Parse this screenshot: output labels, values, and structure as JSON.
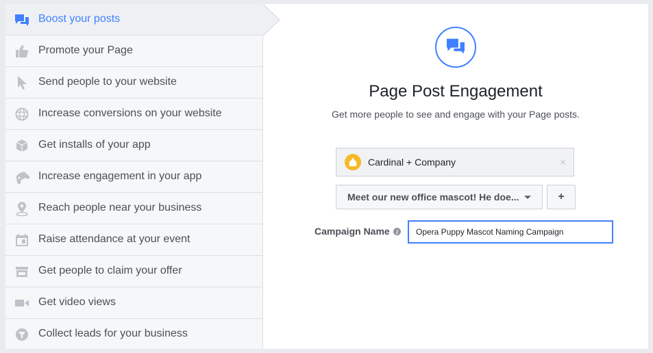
{
  "sidebar": {
    "items": [
      {
        "label": "Boost your posts",
        "icon": "speech-bubbles-icon",
        "active": true
      },
      {
        "label": "Promote your Page",
        "icon": "thumbs-up-icon"
      },
      {
        "label": "Send people to your website",
        "icon": "cursor-icon"
      },
      {
        "label": "Increase conversions on your website",
        "icon": "globe-icon"
      },
      {
        "label": "Get installs of your app",
        "icon": "box-icon"
      },
      {
        "label": "Increase engagement in your app",
        "icon": "gamepad-icon"
      },
      {
        "label": "Reach people near your business",
        "icon": "map-pin-icon"
      },
      {
        "label": "Raise attendance at your event",
        "icon": "calendar-icon"
      },
      {
        "label": "Get people to claim your offer",
        "icon": "store-icon"
      },
      {
        "label": "Get video views",
        "icon": "video-camera-icon"
      },
      {
        "label": "Collect leads for your business",
        "icon": "funnel-icon"
      }
    ]
  },
  "main": {
    "icon": "speech-bubbles-icon",
    "title": "Page Post Engagement",
    "subtitle": "Get more people to see and engage with your Page posts.",
    "page_selector": {
      "name": "Cardinal + Company",
      "close": "×"
    },
    "post_selector": {
      "label": "Meet our new office mascot! He doe..."
    },
    "add_button": "+",
    "campaign_name": {
      "label": "Campaign Name",
      "info": "i",
      "value": "Opera Puppy Mascot Naming Campaign"
    }
  },
  "colors": {
    "accent": "#4080ff",
    "icon_gray": "#bec3c9",
    "avatar": "#f7b928"
  }
}
